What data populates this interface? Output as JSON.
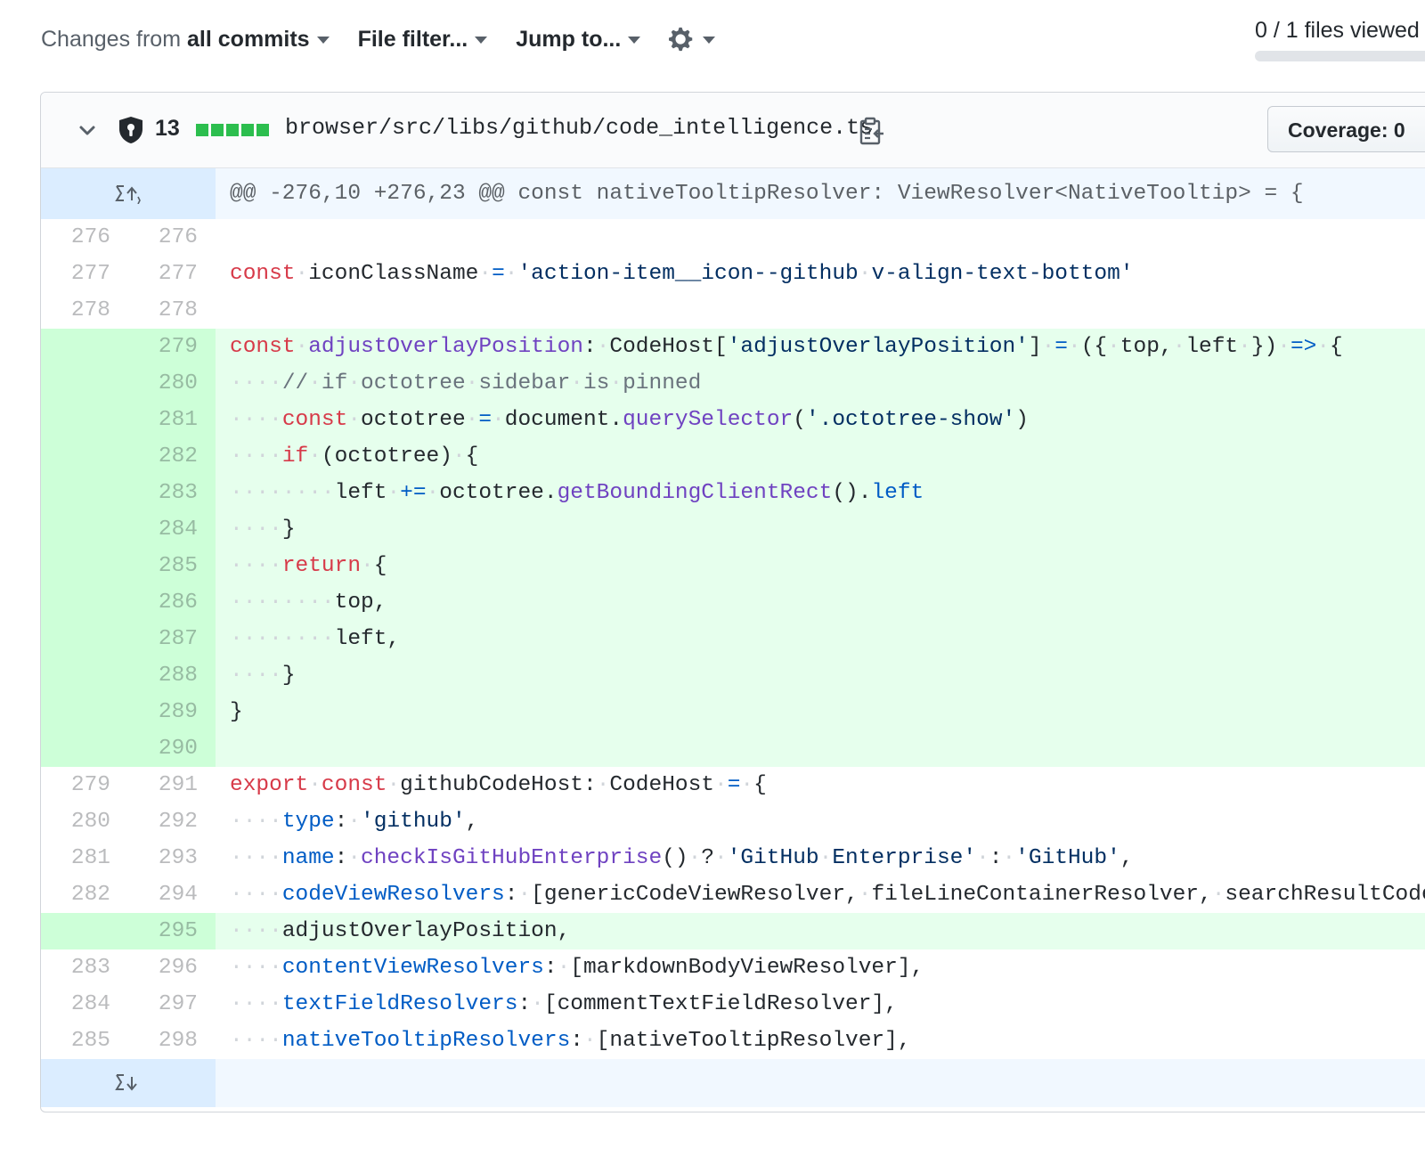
{
  "toolbar": {
    "changes_from_prefix": "Changes from",
    "changes_from_value": "all commits",
    "file_filter": "File filter...",
    "jump_to": "Jump to...",
    "settings_icon": "gear-icon"
  },
  "progress": {
    "text": "0 / 1 files viewed",
    "viewed": 0,
    "total": 1
  },
  "file": {
    "collapse_icon": "chevron-down-icon",
    "security_icon": "shield-lock-icon",
    "changes_count": "13",
    "path": "browser/src/libs/github/code_intelligence.ts",
    "copy_icon": "clipboard-icon",
    "coverage_label": "Coverage: 0",
    "stat_color": "#2cbe4e"
  },
  "diff": {
    "hunk_header": "@@ -276,10 +276,23 @@ const nativeTooltipResolver: ViewResolver<NativeTooltip> = {",
    "expand_up_icon": "expand-up-icon",
    "expand_down_icon": "expand-down-icon",
    "colors": {
      "addition_bg": "#e6ffed",
      "addition_num_bg": "#cdffd8",
      "hunk_bg": "#f1f8ff",
      "expander_bg": "#dbedff"
    },
    "lines": [
      {
        "type": "context",
        "old": "276",
        "new": "276",
        "tokens": []
      },
      {
        "type": "context",
        "old": "277",
        "new": "277",
        "tokens": [
          [
            "k",
            "const"
          ],
          [
            "ws",
            "·"
          ],
          [
            "",
            "iconClassName"
          ],
          [
            "ws",
            "·"
          ],
          [
            "p",
            "="
          ],
          [
            "ws",
            "·"
          ],
          [
            "s",
            "'action-item__icon--github"
          ],
          [
            "ws",
            "·"
          ],
          [
            "s",
            "v-align-text-bottom'"
          ]
        ]
      },
      {
        "type": "context",
        "old": "278",
        "new": "278",
        "tokens": []
      },
      {
        "type": "add",
        "old": "",
        "new": "279",
        "tokens": [
          [
            "k",
            "const"
          ],
          [
            "ws",
            "·"
          ],
          [
            "f",
            "adjustOverlayPosition"
          ],
          [
            "",
            ":"
          ],
          [
            "ws",
            "·"
          ],
          [
            "",
            "CodeHost["
          ],
          [
            "s",
            "'adjustOverlayPosition'"
          ],
          [
            "",
            "]"
          ],
          [
            "ws",
            "·"
          ],
          [
            "p",
            "="
          ],
          [
            "ws",
            "·"
          ],
          [
            "",
            "({"
          ],
          [
            "ws",
            "·"
          ],
          [
            "",
            "top,"
          ],
          [
            "ws",
            "·"
          ],
          [
            "",
            "left"
          ],
          [
            "ws",
            "·"
          ],
          [
            "",
            "})"
          ],
          [
            "ws",
            "·"
          ],
          [
            "p",
            "=>"
          ],
          [
            "ws",
            "·"
          ],
          [
            "",
            "{"
          ]
        ]
      },
      {
        "type": "add",
        "old": "",
        "new": "280",
        "tokens": [
          [
            "ws",
            "····"
          ],
          [
            "c",
            "//"
          ],
          [
            "ws",
            "·"
          ],
          [
            "c",
            "if"
          ],
          [
            "ws",
            "·"
          ],
          [
            "c",
            "octotree"
          ],
          [
            "ws",
            "·"
          ],
          [
            "c",
            "sidebar"
          ],
          [
            "ws",
            "·"
          ],
          [
            "c",
            "is"
          ],
          [
            "ws",
            "·"
          ],
          [
            "c",
            "pinned"
          ]
        ]
      },
      {
        "type": "add",
        "old": "",
        "new": "281",
        "tokens": [
          [
            "ws",
            "····"
          ],
          [
            "k",
            "const"
          ],
          [
            "ws",
            "·"
          ],
          [
            "",
            "octotree"
          ],
          [
            "ws",
            "·"
          ],
          [
            "p",
            "="
          ],
          [
            "ws",
            "·"
          ],
          [
            "",
            "document."
          ],
          [
            "f",
            "querySelector"
          ],
          [
            "",
            "("
          ],
          [
            "s",
            "'.octotree-show'"
          ],
          [
            "",
            ")"
          ]
        ]
      },
      {
        "type": "add",
        "old": "",
        "new": "282",
        "tokens": [
          [
            "ws",
            "····"
          ],
          [
            "k",
            "if"
          ],
          [
            "ws",
            "·"
          ],
          [
            "",
            "(octotree)"
          ],
          [
            "ws",
            "·"
          ],
          [
            "",
            "{"
          ]
        ]
      },
      {
        "type": "add",
        "old": "",
        "new": "283",
        "tokens": [
          [
            "ws",
            "········"
          ],
          [
            "",
            "left"
          ],
          [
            "ws",
            "·"
          ],
          [
            "p",
            "+="
          ],
          [
            "ws",
            "·"
          ],
          [
            "",
            "octotree."
          ],
          [
            "f",
            "getBoundingClientRect"
          ],
          [
            "",
            "()."
          ],
          [
            "p",
            "left"
          ]
        ]
      },
      {
        "type": "add",
        "old": "",
        "new": "284",
        "tokens": [
          [
            "ws",
            "····"
          ],
          [
            "",
            "}"
          ]
        ]
      },
      {
        "type": "add",
        "old": "",
        "new": "285",
        "tokens": [
          [
            "ws",
            "····"
          ],
          [
            "k",
            "return"
          ],
          [
            "ws",
            "·"
          ],
          [
            "",
            "{"
          ]
        ]
      },
      {
        "type": "add",
        "old": "",
        "new": "286",
        "tokens": [
          [
            "ws",
            "········"
          ],
          [
            "",
            "top,"
          ]
        ]
      },
      {
        "type": "add",
        "old": "",
        "new": "287",
        "tokens": [
          [
            "ws",
            "········"
          ],
          [
            "",
            "left,"
          ]
        ]
      },
      {
        "type": "add",
        "old": "",
        "new": "288",
        "tokens": [
          [
            "ws",
            "····"
          ],
          [
            "",
            "}"
          ]
        ]
      },
      {
        "type": "add",
        "old": "",
        "new": "289",
        "tokens": [
          [
            "",
            "}"
          ]
        ]
      },
      {
        "type": "add",
        "old": "",
        "new": "290",
        "tokens": []
      },
      {
        "type": "context",
        "old": "279",
        "new": "291",
        "tokens": [
          [
            "k",
            "export"
          ],
          [
            "ws",
            "·"
          ],
          [
            "k",
            "const"
          ],
          [
            "ws",
            "·"
          ],
          [
            "",
            "githubCodeHost:"
          ],
          [
            "ws",
            "·"
          ],
          [
            "",
            "CodeHost"
          ],
          [
            "ws",
            "·"
          ],
          [
            "p",
            "="
          ],
          [
            "ws",
            "·"
          ],
          [
            "",
            "{"
          ]
        ]
      },
      {
        "type": "context",
        "old": "280",
        "new": "292",
        "tokens": [
          [
            "ws",
            "····"
          ],
          [
            "p",
            "type"
          ],
          [
            "",
            ":"
          ],
          [
            "ws",
            "·"
          ],
          [
            "s",
            "'github'"
          ],
          [
            "",
            ","
          ]
        ]
      },
      {
        "type": "context",
        "old": "281",
        "new": "293",
        "tokens": [
          [
            "ws",
            "····"
          ],
          [
            "p",
            "name"
          ],
          [
            "",
            ":"
          ],
          [
            "ws",
            "·"
          ],
          [
            "f",
            "checkIsGitHubEnterprise"
          ],
          [
            "",
            "()"
          ],
          [
            "ws",
            "·"
          ],
          [
            "",
            "?"
          ],
          [
            "ws",
            "·"
          ],
          [
            "s",
            "'GitHub"
          ],
          [
            "ws",
            "·"
          ],
          [
            "s",
            "Enterprise'"
          ],
          [
            "ws",
            "·"
          ],
          [
            "",
            ":"
          ],
          [
            "ws",
            "·"
          ],
          [
            "s",
            "'GitHub'"
          ],
          [
            "",
            ","
          ]
        ]
      },
      {
        "type": "context",
        "old": "282",
        "new": "294",
        "tokens": [
          [
            "ws",
            "····"
          ],
          [
            "p",
            "codeViewResolvers"
          ],
          [
            "",
            ":"
          ],
          [
            "ws",
            "·"
          ],
          [
            "",
            "[genericCodeViewResolver,"
          ],
          [
            "ws",
            "·"
          ],
          [
            "",
            "fileLineContainerResolver,"
          ],
          [
            "ws",
            "·"
          ],
          [
            "",
            "searchResultCodeViewResolver],"
          ]
        ]
      },
      {
        "type": "add",
        "old": "",
        "new": "295",
        "tokens": [
          [
            "ws",
            "····"
          ],
          [
            "",
            "adjustOverlayPosition,"
          ]
        ]
      },
      {
        "type": "context",
        "old": "283",
        "new": "296",
        "tokens": [
          [
            "ws",
            "····"
          ],
          [
            "p",
            "contentViewResolvers"
          ],
          [
            "",
            ":"
          ],
          [
            "ws",
            "·"
          ],
          [
            "",
            "[markdownBodyViewResolver],"
          ]
        ]
      },
      {
        "type": "context",
        "old": "284",
        "new": "297",
        "tokens": [
          [
            "ws",
            "····"
          ],
          [
            "p",
            "textFieldResolvers"
          ],
          [
            "",
            ":"
          ],
          [
            "ws",
            "·"
          ],
          [
            "",
            "[commentTextFieldResolver],"
          ]
        ]
      },
      {
        "type": "context",
        "old": "285",
        "new": "298",
        "tokens": [
          [
            "ws",
            "····"
          ],
          [
            "p",
            "nativeTooltipResolvers"
          ],
          [
            "",
            ":"
          ],
          [
            "ws",
            "·"
          ],
          [
            "",
            "[nativeTooltipResolver],"
          ]
        ]
      }
    ]
  }
}
